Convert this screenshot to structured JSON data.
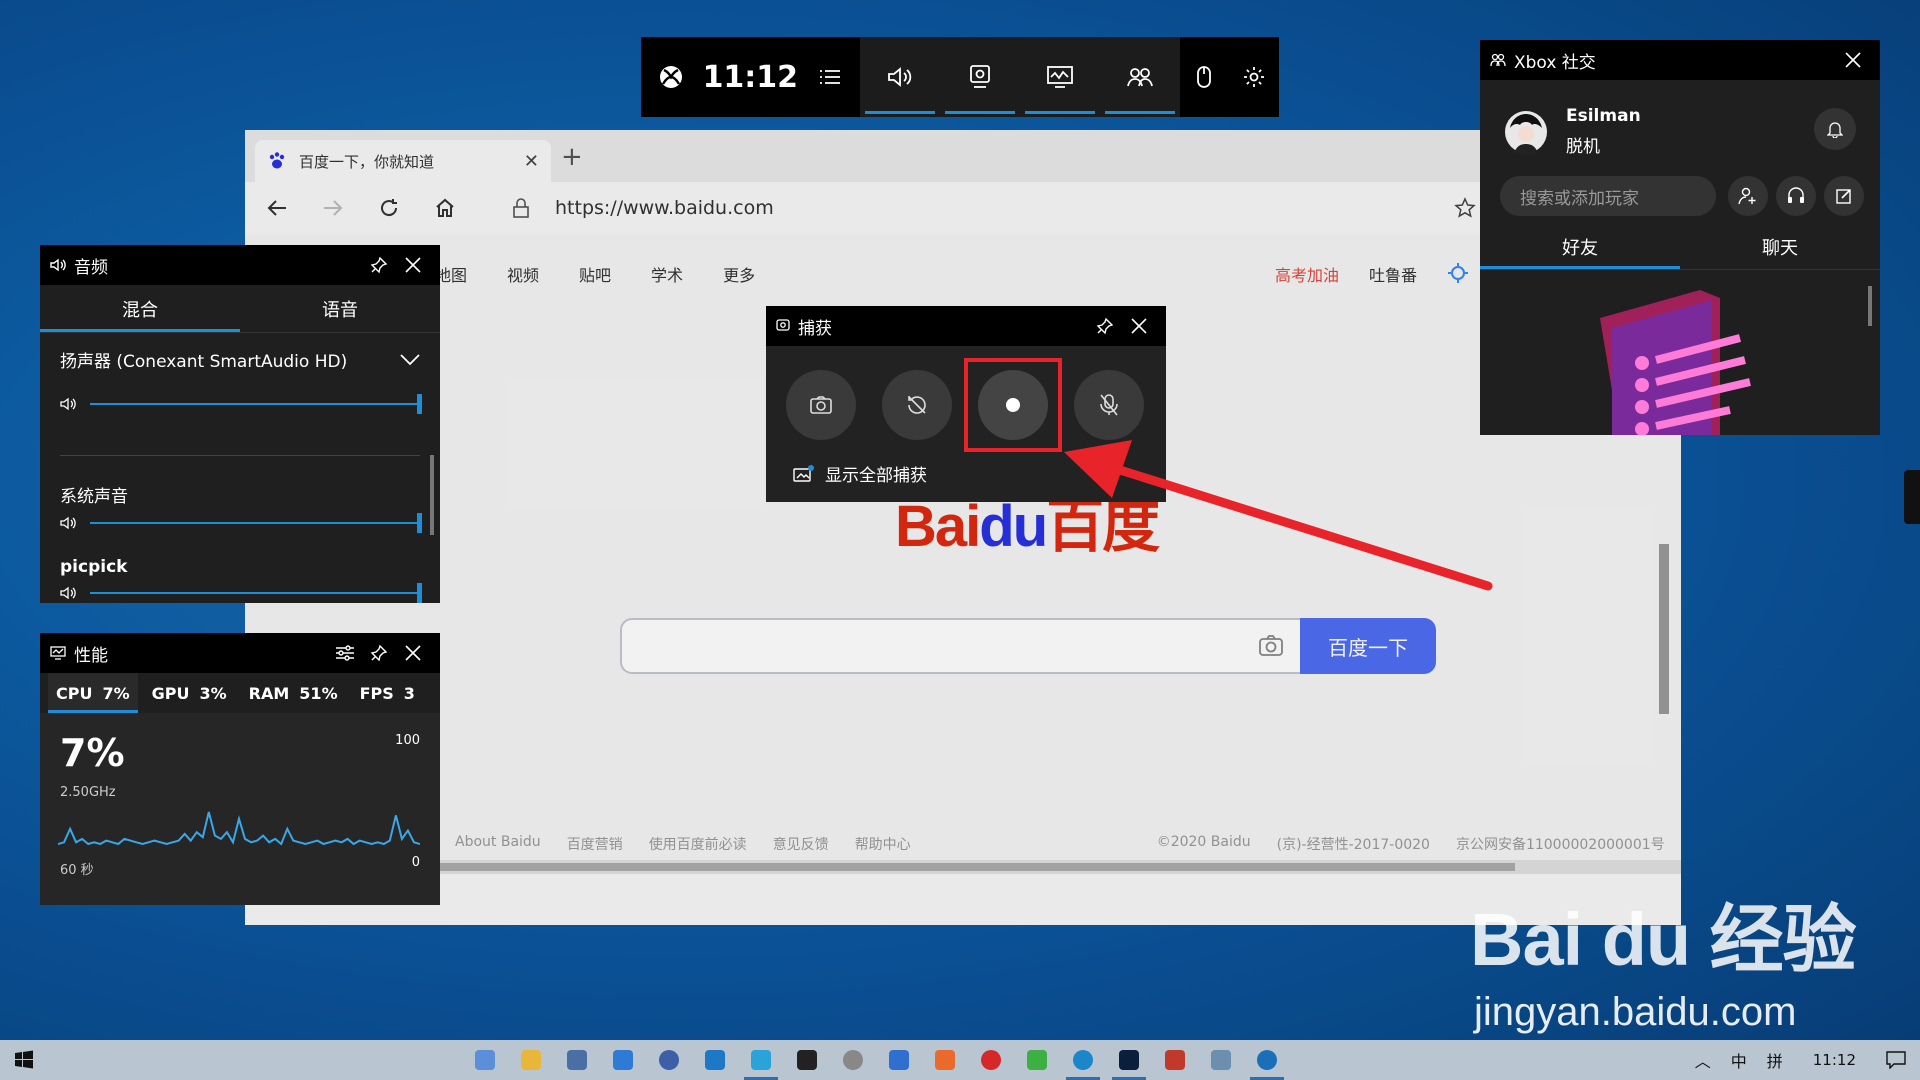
{
  "gamebar": {
    "time": "11:12",
    "colors": {
      "accent": "#1f8ed8"
    }
  },
  "browser": {
    "tab_title": "百度一下，你就知道",
    "url": "https://www.baidu.com",
    "nav": [
      "地图",
      "视频",
      "贴吧",
      "学术",
      "更多"
    ],
    "right_links": [
      {
        "text": "高考加油",
        "color": "#e2473e"
      },
      {
        "text": "吐鲁番",
        "color": "#333333"
      }
    ],
    "search_button": "百度一下",
    "footer": [
      "About Baidu",
      "百度营销",
      "使用百度前必读",
      "意见反馈",
      "帮助中心",
      "©2020 Baidu",
      "(京)-经营性-2017-0020",
      "京公网安备11000002000001号"
    ]
  },
  "audio": {
    "title": "音频",
    "tabs": [
      "混合",
      "语音"
    ],
    "device": "扬声器 (Conexant SmartAudio HD)",
    "apps": [
      {
        "label": "系统声音",
        "volume": 100
      },
      {
        "label": "picpick",
        "volume": 100
      }
    ],
    "device_volume": 100
  },
  "performance": {
    "title": "性能",
    "tabs": [
      {
        "name": "CPU",
        "value": "7%"
      },
      {
        "name": "GPU",
        "value": "3%"
      },
      {
        "name": "RAM",
        "value": "51%"
      },
      {
        "name": "FPS",
        "value": "3"
      }
    ],
    "big_value": "7%",
    "frequency": "2.50GHz",
    "max_label": "100",
    "min_label": "0",
    "time_label": "60 秒",
    "graph_values": [
      3,
      4,
      12,
      4,
      6,
      3,
      4,
      3,
      5,
      4,
      3,
      6,
      5,
      4,
      3,
      4,
      5,
      4,
      3,
      4,
      5,
      9,
      5,
      10,
      7,
      22,
      8,
      6,
      10,
      4,
      18,
      6,
      4,
      5,
      8,
      4,
      6,
      3,
      12,
      5,
      4,
      3,
      4,
      5,
      3,
      4,
      5,
      4,
      6,
      3,
      5,
      4,
      3,
      4,
      3,
      5,
      20,
      6,
      11,
      4,
      3
    ],
    "y_range": [
      0,
      100
    ]
  },
  "capture": {
    "title": "捕获",
    "show_all": "显示全部捕获",
    "highlight_color": "#e8232a"
  },
  "social": {
    "title": "Xbox 社交",
    "user_name": "Esilman",
    "status": "脱机",
    "search_placeholder": "搜索或添加玩家",
    "tabs": [
      "好友",
      "聊天"
    ]
  },
  "watermark": {
    "logo": "Bai du 经验",
    "url": "jingyan.baidu.com"
  },
  "taskbar": {
    "tray_ime": "中",
    "tray_ime2": "拼",
    "time": "11:12"
  }
}
